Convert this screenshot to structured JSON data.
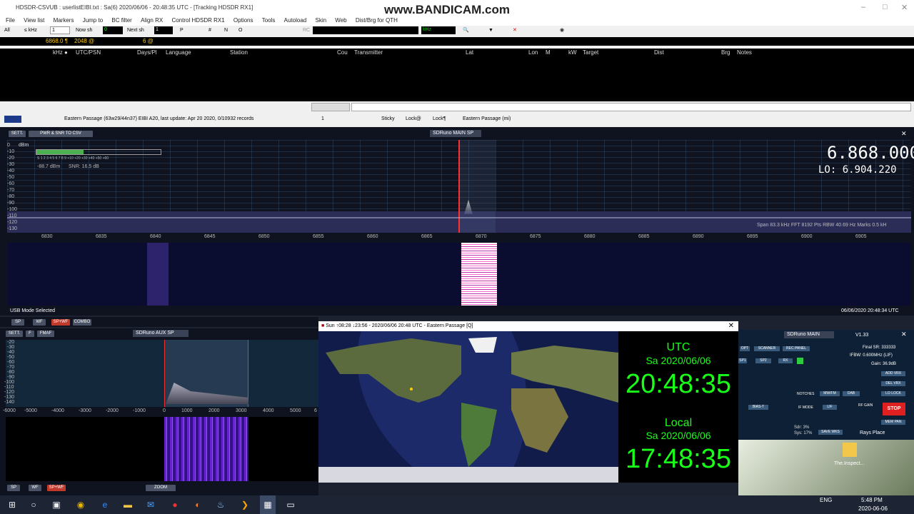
{
  "window": {
    "title": "HDSDR-CSVUB : userlistEIBI.txt : Sa(6) 2020/06/06 - 20:48:35 UTC - [Tracking HDSDR RX1]",
    "watermark": "www.BANDICAM.com"
  },
  "menu": [
    "File",
    "View list",
    "Markers",
    "Jump to",
    "BC filter",
    "Align RX",
    "Control HDSDR RX1",
    "Options",
    "Tools",
    "Autoload",
    "Skin",
    "Web",
    "Dist/Brg for QTH"
  ],
  "toolbar": {
    "all": "All",
    "khz": "≤ kHz",
    "khz_val": "1",
    "now": "Now sh",
    "now_val": "0",
    "next": "Next sh",
    "next_val": "1",
    "p": "P",
    "hash": "#",
    "n": "N",
    "o": "O",
    "rc": "RC",
    "unit": "kHz"
  },
  "freqline": {
    "freq": "6868.0 ¶",
    "count": "2048 @",
    "six": "6 @"
  },
  "columns": [
    "kHz ●",
    "UTC/PSN",
    "Days/Pl",
    "Language",
    "Station",
    "Cou",
    "Transmitter",
    "Lat",
    "Lon",
    "M",
    "kW",
    "Target",
    "Dist",
    "Brg",
    "Notes"
  ],
  "status": {
    "station": "Eastern Passage (63w29/44n37) EIBI A20, last update: Apr 20 2020, 0/10932 records",
    "page": "1",
    "sticky": "Sticky",
    "lock": "Lock@",
    "lock2": "Lock¶",
    "station2": "Eastern Passage (mi)"
  },
  "sdr": {
    "sett": "SETT.",
    "pwr": "PWR & SNR TO CSV",
    "brand": "SDRuno",
    "mainsp": "MAIN SP",
    "freq": "6.868.000",
    "lo": "LO:   6.904.220",
    "dbm": "dBm",
    "level": "-88.7 dBm",
    "snr": "SNR: 16.5 dB",
    "scale": "S  1  2  3  4  5  6  7  8  9  +10 +20 +30 +40 +50 +60",
    "dblabels": [
      "0",
      "-10",
      "-20",
      "-30",
      "-40",
      "-50",
      "-60",
      "-70",
      "-80",
      "-90",
      "-100",
      "-110",
      "-120",
      "-130"
    ],
    "freqs": [
      "6830",
      "6835",
      "6840",
      "6845",
      "6850",
      "6855",
      "6860",
      "6865",
      "6870",
      "6875",
      "6880",
      "6885",
      "6890",
      "6895",
      "6900",
      "6905"
    ],
    "span": "Span 83.3 kHz  FFT 8192 Pts  RBW 40.69 Hz  Marks 0.5 kH",
    "mode": "USB Mode Selected",
    "datetime": "06/06/2020 20:48:34 UTC",
    "sp": "SP",
    "wf": "WF",
    "spwf": "SP+WF",
    "combo": "COMBO"
  },
  "aux": {
    "sett": "SETT.",
    "f": "F",
    "fmaf": "FMAF",
    "brand": "SDRuno",
    "name": "AUX SP",
    "db": [
      "-20",
      "-30",
      "-40",
      "-50",
      "-60",
      "-70",
      "-80",
      "-90",
      "-100",
      "-110",
      "-120",
      "-130",
      "-140"
    ],
    "xt": [
      "-6000",
      "-5000",
      "-4000",
      "-3000",
      "-2000",
      "-1000",
      "0",
      "1000",
      "2000",
      "3000",
      "4000",
      "5000",
      "6"
    ],
    "zoom": "ZOOM",
    "sp": "SP",
    "wf": "WF",
    "spwf": "SP+WF"
  },
  "clock": {
    "title": "Sun ↑08:28 ↓23:56 - 2020/06/06 20:48 UTC - Eastern Passage [Q]",
    "utc_label": "UTC",
    "utc_date": "Sa 2020/06/06",
    "utc_time": "20:48:35",
    "local_label": "Local",
    "local_date": "Sa 2020/06/06",
    "local_time": "17:48:35"
  },
  "main": {
    "brand": "SDRuno",
    "name": "MAIN",
    "ver": "V1.33",
    "sr": "Final SR: 333333",
    "ifbw": "IFBW: 0.600MHz (LIF)",
    "gain": "Gain: 36.9dB",
    "opt": "OPT",
    "scanner": "SCANNER",
    "recpanel": "REC PANEL",
    "sp1": "SP1",
    "sp2": "SP2",
    "rx": "RX",
    "addvrx": "ADD VRX",
    "delvrx": "DEL VRX",
    "lolock": "LO LOCK",
    "notches": "NOTCHES",
    "mwfm": "MW/FM",
    "dab": "DAB",
    "ifmode": "IF MODE",
    "lif": "LIF",
    "rfgain": "RF GAIN",
    "stop": "STOP",
    "memsave": "MEM SAVE",
    "memman": "MEM PAN",
    "biast": "BIAS-T",
    "sdr": "Sdr: 3%",
    "sys": "Sys: 17%",
    "savewks": "SAVE WKS",
    "rays": "Rays Place"
  },
  "desktop": {
    "icon_label": "The.Inspect..."
  },
  "taskbar": {
    "time": "5:48 PM",
    "date": "2020-06-06",
    "lang": "ENG"
  },
  "colors": {
    "accent_green": "#18ff18",
    "sdr_bg": "#0f1320",
    "stop_red": "#e02020"
  }
}
